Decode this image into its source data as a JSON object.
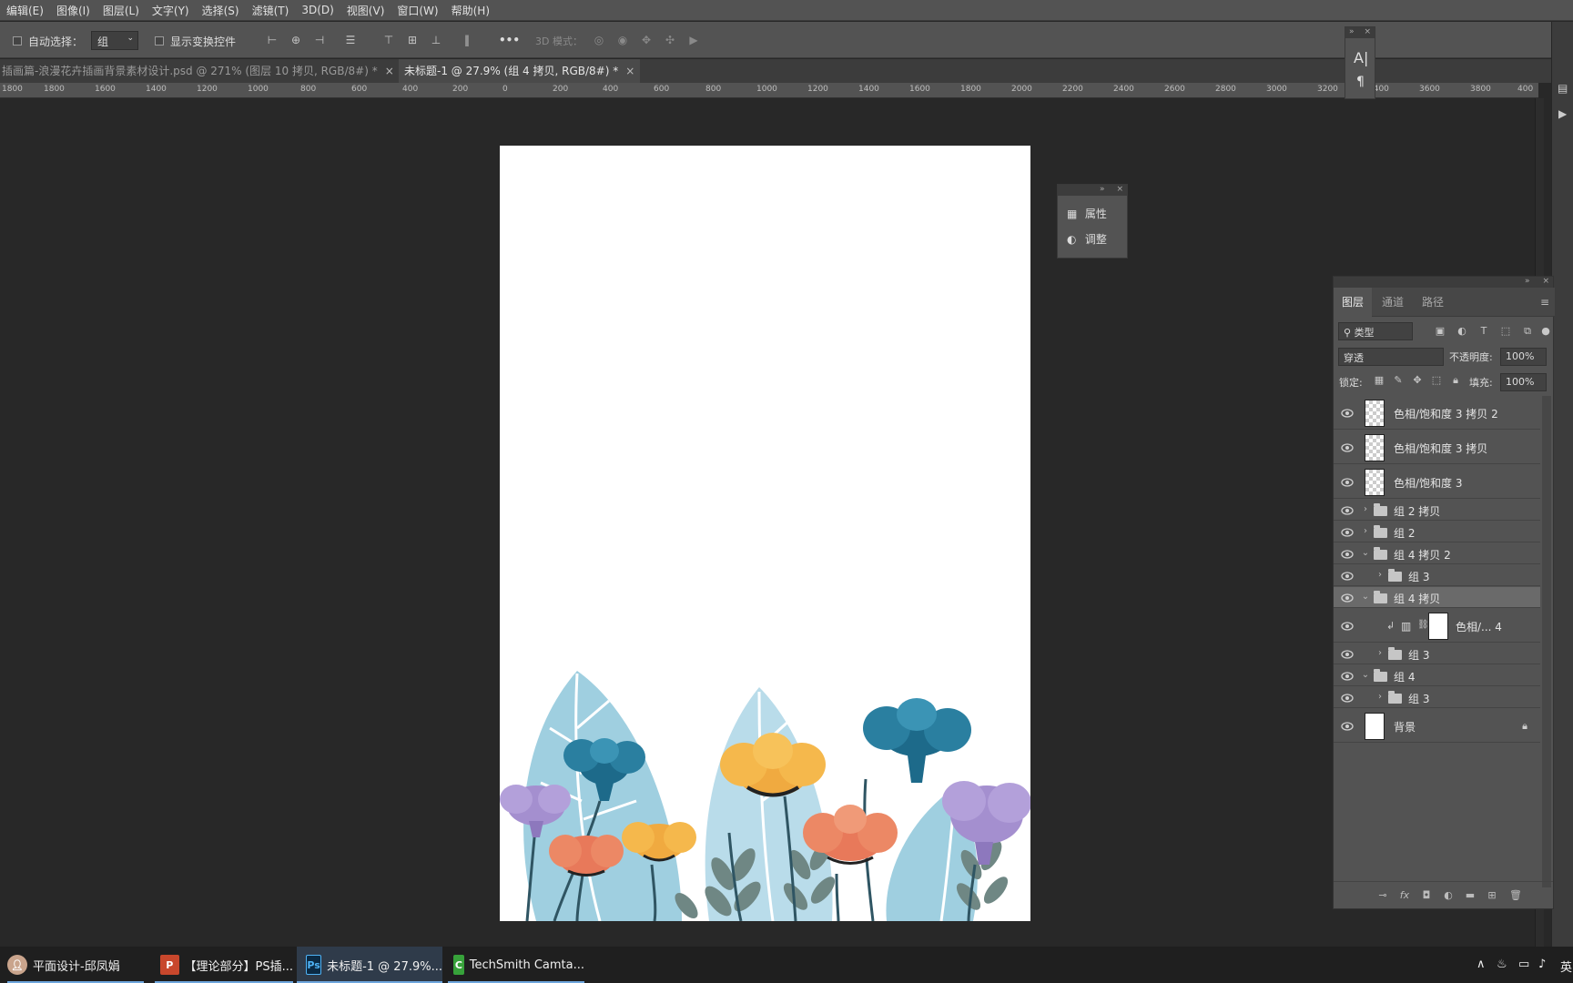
{
  "menu": [
    "编辑(E)",
    "图像(I)",
    "图层(L)",
    "文字(Y)",
    "选择(S)",
    "滤镜(T)",
    "3D(D)",
    "视图(V)",
    "窗口(W)",
    "帮助(H)"
  ],
  "options": {
    "auto_select_label": "自动选择：",
    "auto_select_value": "组",
    "show_transform_label": "显示变换控件",
    "more_label": "•••",
    "mode_3d_label": "3D 模式："
  },
  "tabs": [
    {
      "label": "插画篇-浪漫花卉插画背景素材设计.psd @ 271% (图层 10 拷贝, RGB/8#) *",
      "close": "×"
    },
    {
      "label": "未标题-1 @ 27.9% (组 4 拷贝, RGB/8#) *",
      "close": "×"
    }
  ],
  "ruler_labels": [
    "1800",
    "1600",
    "1400",
    "1200",
    "1000",
    "800",
    "600",
    "400",
    "200",
    "0",
    "200",
    "400",
    "600",
    "800",
    "1000",
    "1200",
    "1400",
    "1600",
    "1800",
    "2000",
    "2200",
    "2400",
    "2600",
    "2800",
    "3000",
    "3200",
    "3400",
    "3600",
    "3800",
    "400"
  ],
  "char_panel": {
    "char_icon": "A|",
    "para_icon": "¶"
  },
  "props_panel": {
    "properties": "属性",
    "adjustments": "调整"
  },
  "layers_panel": {
    "tabs": [
      "图层",
      "通道",
      "路径"
    ],
    "filter_label": "类型",
    "blend_mode": "穿透",
    "opacity_label": "不透明度:",
    "opacity_value": "100%",
    "lock_label": "锁定:",
    "fill_label": "填充:",
    "fill_value": "100%",
    "layers": [
      {
        "name": "色相/饱和度 3 拷贝 2",
        "kind": "adjustment"
      },
      {
        "name": "色相/饱和度 3 拷贝",
        "kind": "adjustment"
      },
      {
        "name": "色相/饱和度 3",
        "kind": "adjustment"
      },
      {
        "name": "组 2 拷贝",
        "kind": "group"
      },
      {
        "name": "组 2",
        "kind": "group"
      },
      {
        "name": "组 4 拷贝 2",
        "kind": "group-open"
      },
      {
        "name": "组 3",
        "kind": "group"
      },
      {
        "name": "组 4 拷贝",
        "kind": "group-open",
        "selected": true
      },
      {
        "name": "色相/... 4",
        "kind": "clipped-adjustment"
      },
      {
        "name": "组 3",
        "kind": "group"
      },
      {
        "name": "组 4",
        "kind": "group-open"
      },
      {
        "name": "组 3",
        "kind": "group"
      },
      {
        "name": "背景",
        "kind": "background"
      }
    ]
  },
  "taskbar": {
    "items": [
      {
        "label": "平面设计-邱凤娟",
        "icon": "avatar"
      },
      {
        "label": "【理论部分】PS插...",
        "icon": "P"
      },
      {
        "label": "未标题-1 @ 27.9%...",
        "icon": "Ps"
      },
      {
        "label": "TechSmith Camta...",
        "icon": "C"
      }
    ],
    "ime": "英"
  },
  "colors": {
    "leaf": "#9fcfe0",
    "teal": "#1d6a8a",
    "orange": "#f0aa40",
    "coral": "#e8795a",
    "purple": "#a48fcf",
    "stem": "#375a66",
    "greenleaf": "#6f8784"
  }
}
